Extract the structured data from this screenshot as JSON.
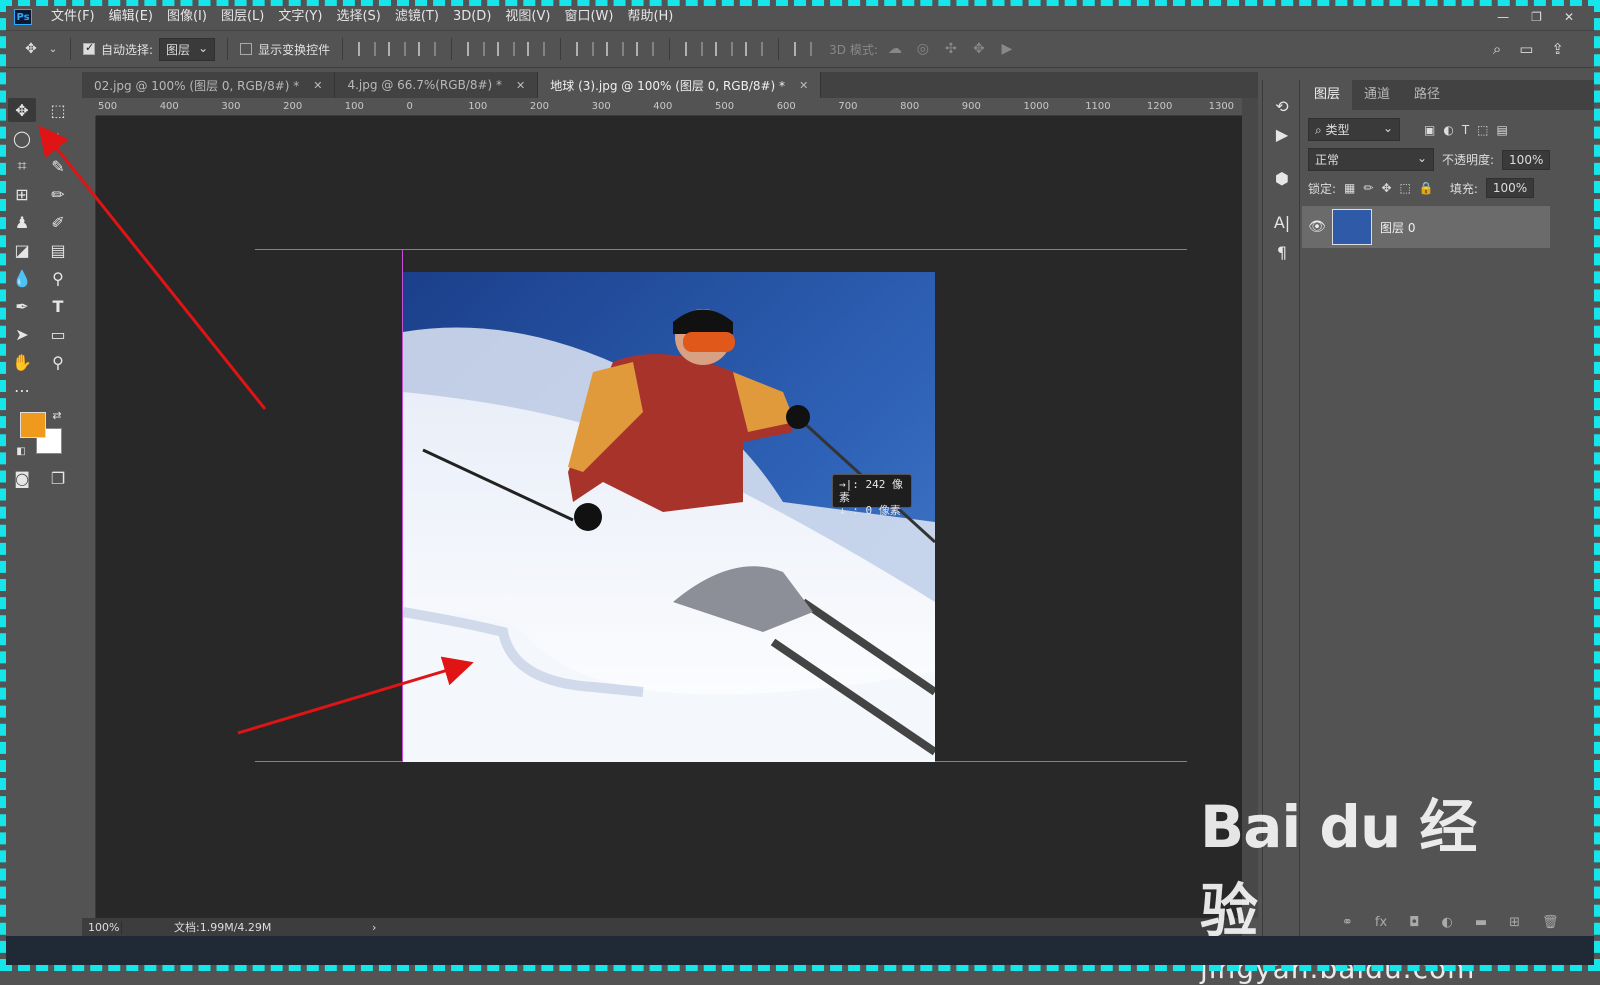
{
  "menubar": {
    "logo": "Ps",
    "items": [
      "文件(F)",
      "编辑(E)",
      "图像(I)",
      "图层(L)",
      "文字(Y)",
      "选择(S)",
      "滤镜(T)",
      "3D(D)",
      "视图(V)",
      "窗口(W)",
      "帮助(H)"
    ]
  },
  "options": {
    "auto_select_label": "自动选择:",
    "auto_select_value": "图层",
    "show_transform_label": "显示变换控件",
    "mode_3d_label": "3D 模式:"
  },
  "tabs": [
    {
      "label": "02.jpg @ 100% (图层 0, RGB/8#) *"
    },
    {
      "label": "4.jpg @ 66.7%(RGB/8#) *"
    },
    {
      "label": "地球 (3).jpg @ 100% (图层 0, RGB/8#) *"
    }
  ],
  "ruler_h": [
    "500",
    "400",
    "300",
    "200",
    "100",
    "0",
    "100",
    "200",
    "300",
    "400",
    "500",
    "600",
    "700",
    "800",
    "900",
    "1000",
    "1100",
    "1200",
    "1300"
  ],
  "tooltip": {
    "line1": "→|: 242 像素",
    "line2": "↓ :   0 像素"
  },
  "status": {
    "zoom": "100%",
    "doc": "文档:1.99M/4.29M",
    "arrow": "›"
  },
  "panel": {
    "tabs": [
      "图层",
      "通道",
      "路径"
    ],
    "filter_label": "⌕ 类型",
    "blend_mode": "正常",
    "opacity_label": "不透明度:",
    "opacity_value": "100%",
    "lock_label": "锁定:",
    "fill_label": "填充:",
    "fill_value": "100%",
    "layers": [
      {
        "name": "图层 0"
      }
    ]
  },
  "watermark": {
    "logo": "Bai du 经验",
    "url": "jingyan.baidu.com"
  },
  "colors": {
    "foreground": "#f09a1d",
    "background": "#ffffff",
    "guide": "#c64fd8",
    "frame": "#16e6ea",
    "arrow": "#e01414"
  }
}
